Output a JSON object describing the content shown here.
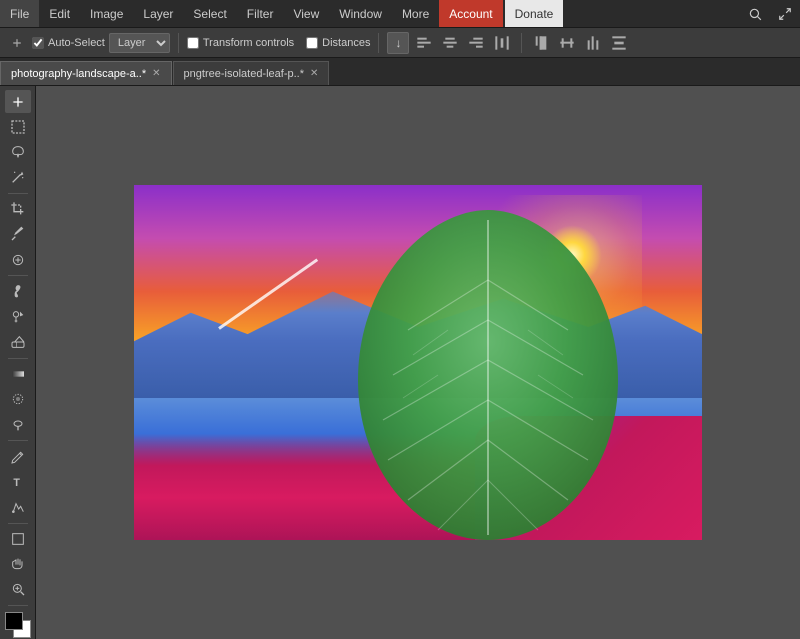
{
  "menubar": {
    "items": [
      {
        "id": "file",
        "label": "File"
      },
      {
        "id": "edit",
        "label": "Edit"
      },
      {
        "id": "image",
        "label": "Image"
      },
      {
        "id": "layer",
        "label": "Layer"
      },
      {
        "id": "select",
        "label": "Select"
      },
      {
        "id": "filter",
        "label": "Filter"
      },
      {
        "id": "view",
        "label": "View"
      },
      {
        "id": "window",
        "label": "Window"
      },
      {
        "id": "more",
        "label": "More"
      },
      {
        "id": "account",
        "label": "Account"
      },
      {
        "id": "donate",
        "label": "Donate"
      }
    ]
  },
  "toolbar": {
    "auto_select_label": "Auto-Select",
    "layer_label": "Layer",
    "transform_controls_label": "Transform controls",
    "distances_label": "Distances"
  },
  "tabs": [
    {
      "id": "tab1",
      "label": "photography-landscape-a..*",
      "active": true
    },
    {
      "id": "tab2",
      "label": "pngtree-isolated-leaf-p..*",
      "active": false
    }
  ],
  "tools": [
    {
      "id": "move",
      "icon": "move"
    },
    {
      "id": "select-rect",
      "icon": "rect-select"
    },
    {
      "id": "lasso",
      "icon": "lasso"
    },
    {
      "id": "magic-wand",
      "icon": "magic-wand"
    },
    {
      "id": "crop",
      "icon": "crop"
    },
    {
      "id": "eyedropper",
      "icon": "eyedropper"
    },
    {
      "id": "heal",
      "icon": "heal"
    },
    {
      "id": "brush",
      "icon": "brush"
    },
    {
      "id": "clone",
      "icon": "clone"
    },
    {
      "id": "eraser",
      "icon": "eraser"
    },
    {
      "id": "gradient",
      "icon": "gradient"
    },
    {
      "id": "blur",
      "icon": "blur"
    },
    {
      "id": "dodge",
      "icon": "dodge"
    },
    {
      "id": "pen",
      "icon": "pen"
    },
    {
      "id": "text",
      "icon": "text"
    },
    {
      "id": "path-select",
      "icon": "path-select"
    },
    {
      "id": "shape",
      "icon": "shape"
    },
    {
      "id": "hand",
      "icon": "hand"
    },
    {
      "id": "zoom",
      "icon": "zoom"
    }
  ],
  "colors": {
    "bg": "#3c3c3c",
    "menubar_bg": "#2b2b2b",
    "active_menu": "#c0392b",
    "donate_bg": "#e8e8e8"
  }
}
